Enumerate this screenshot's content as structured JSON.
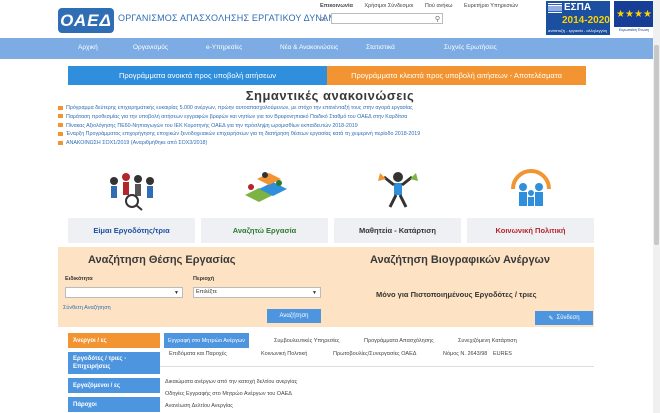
{
  "header": {
    "logo_text": "ΟΑΕΔ",
    "org_name": "ΟΡΓΑΝΙΣΜΟΣ ΑΠΑΣΧΟΛΗΣΗΣ ΕΡΓΑΤΙΚΟΥ ΔΥΝΑΜΙΚΟΥ",
    "top_links": [
      "Επικοινωνία",
      "Χρήσιμοι Σύνδεσμοι",
      "Πού ανήκω",
      "Ευρετήριο Υπηρεσιών"
    ],
    "lang": "EL",
    "search_placeholder": "",
    "search_icon": "search-icon",
    "espa": {
      "title": "ΕΣΠΑ",
      "years": "2014-2020",
      "slogan": "ανάπτυξη - εργασία - αλληλεγγύη"
    },
    "eu": {
      "caption": "Ευρωπαϊκή Ένωση",
      "stars": "★★★★"
    }
  },
  "nav": {
    "items": [
      "Αρχική",
      "Οργανισμός",
      "e-Υπηρεσίες",
      "Νέα & Ανακοινώσεις",
      "Στατιστικά",
      "Συχνές Ερωτήσεις"
    ]
  },
  "programs": {
    "open": "Προγράμματα ανοικτά προς υποβολή αιτήσεων",
    "closed": "Προγράμματα κλειστά προς υποβολή αιτήσεων - Αποτελέσματα"
  },
  "announcements": {
    "title": "Σημαντικές ανακοινώσεις",
    "items": [
      "Πρόγραμμα δεύτερης επιχειρηματικής ευκαιρίας 5.000 ανέργων, πρώην αυτοαπασχολούμενων, με στόχο την επανένταξή τους στην αγορά εργασίας",
      "Παράταση προθεσμίας για την υποβολή αιτήσεων εγγραφών βρεφών και νηπίων για τον Βρεφονηπιακό Παιδικό Σταθμό του ΟΑΕΔ στην Καρδίτσα",
      "Πίνακας Αξιολόγησης ΠΕ60-Νηπιαγωγών του ΙΕΚ Κομοτηνής ΟΑΕΔ για την πρόσληψη ωρομισθίων εκπαιδευτών 2018-2019",
      "Έναρξη Προγράμματος επιχορήγησης εποχικών ξενοδοχειακών επιχειρήσεων για τη διατήρηση θέσεων εργασίας κατά τη χειμερινή περίοδο 2018-2019",
      "ΑΝΑΚΟΙΝΩΣΗ ΣΟΧ1/2019 (Αναριθμήθηκε από ΣΟΧ3/2018)"
    ]
  },
  "tiles": [
    {
      "label": "Είμαι Εργοδότης/τρια",
      "icon": "employer-people-icon"
    },
    {
      "label": "Αναζητώ Εργασία",
      "icon": "job-search-icon"
    },
    {
      "label": "Μαθητεία - Κατάρτιση",
      "icon": "apprenticeship-icon"
    },
    {
      "label": "Κοινωνική Πολιτική",
      "icon": "social-policy-icon"
    }
  ],
  "job_search": {
    "title": "Αναζήτηση Θέσης Εργασίας",
    "specialty_label": "Ειδικότητα",
    "specialty_value": "",
    "region_label": "Περιοχή",
    "region_value": "Επιλέξτε",
    "advanced_link": "Σύνθετη Αναζήτηση",
    "search_button": "Αναζήτηση"
  },
  "cv_search": {
    "title": "Αναζήτηση Βιογραφικών Ανέργων",
    "note": "Μόνο για Πιστοποιημένους Εργοδότες / τριες",
    "login_button": "Σύνδεση",
    "login_icon": "login-icon"
  },
  "left_menu": [
    {
      "label": "Άνεργοι / ες",
      "color": "#f29432"
    },
    {
      "label": "Εργοδότες / τριες - Επιχειρήσεις",
      "color": "#4d95de"
    },
    {
      "label": "Εργαζόμενοι / ες",
      "color": "#4d95de"
    },
    {
      "label": "Πάροχοι",
      "color": "#4d95de"
    }
  ],
  "tabs": [
    "Εγγραφή στο Μητρώο Ανέργων",
    "Συμβουλευτικές Υπηρεσίες",
    "Προγράμματα Απασχόλησης",
    "Συνεχιζόμενη Κατάρτιση"
  ],
  "sub_tabs": [
    "Επιδόματα και Παροχές",
    "Κοινωνική Πολιτική",
    "Πρωτοβουλίες/Συνεργασίες ΟΑΕΔ",
    "Νόμος Ν. 2643/98",
    "EURES"
  ],
  "content_list": [
    "Δικαιώματα ανέργων από την κατοχή δελτίου ανεργίας",
    "Οδηγίες Εγγραφής στο Μητρώο Ανέργων του ΟΑΕΔ",
    "Ανανέωση Δελτίου Ανεργίας"
  ],
  "colors": {
    "nav": "#7cace3",
    "accent_blue": "#2f8fdc",
    "accent_orange": "#f29432",
    "panel": "#fde3c4"
  }
}
